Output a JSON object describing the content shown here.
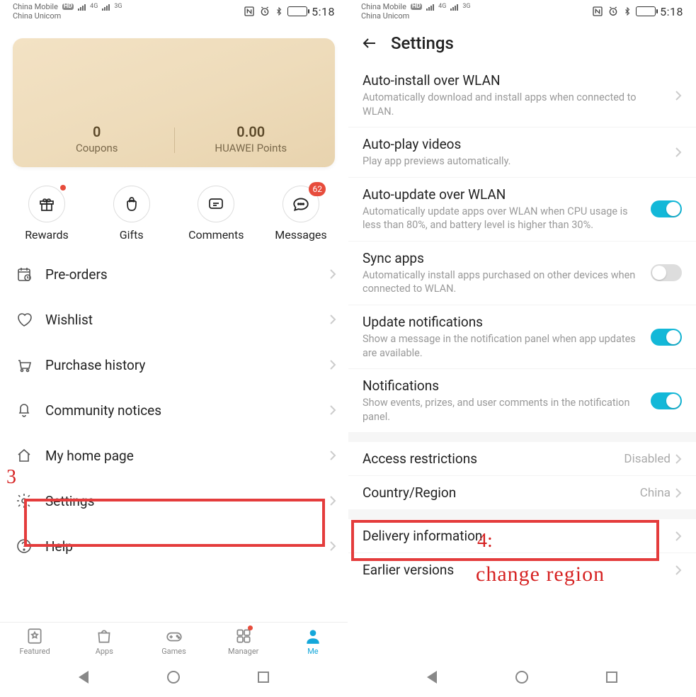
{
  "status": {
    "carrier1": "China Mobile",
    "carrier2": "China Unicom",
    "netlabel1": "4G",
    "netlabel2": "3G",
    "time": "5:18"
  },
  "left": {
    "coupons_val": "0",
    "coupons_label": "Coupons",
    "points_val": "0.00",
    "points_label": "HUAWEI Points",
    "icons": {
      "rewards": "Rewards",
      "gifts": "Gifts",
      "comments": "Comments",
      "messages": "Messages",
      "messages_badge": "62"
    },
    "menu": {
      "preorders": "Pre-orders",
      "wishlist": "Wishlist",
      "purchase": "Purchase history",
      "community": "Community notices",
      "myhome": "My home page",
      "settings": "Settings",
      "help": "Help"
    },
    "tabs": {
      "featured": "Featured",
      "apps": "Apps",
      "games": "Games",
      "manager": "Manager",
      "me": "Me"
    }
  },
  "right": {
    "title": "Settings",
    "items": {
      "autoinstall_t": "Auto-install over WLAN",
      "autoinstall_d": "Automatically download and install apps when connected to WLAN.",
      "autoplay_t": "Auto-play videos",
      "autoplay_d": "Play app previews automatically.",
      "autoupdate_t": "Auto-update over WLAN",
      "autoupdate_d": "Automatically update apps over WLAN when CPU usage is less than 80%, and battery level is higher than 30%.",
      "sync_t": "Sync apps",
      "sync_d": "Automatically install apps purchased on other devices when connected to WLAN.",
      "updatenotif_t": "Update notifications",
      "updatenotif_d": "Show a message in the notification panel when app updates are available.",
      "notif_t": "Notifications",
      "notif_d": "Show events, prizes, and user comments in the notification panel.",
      "access_t": "Access restrictions",
      "access_v": "Disabled",
      "country_t": "Country/Region",
      "country_v": "China",
      "delivery_t": "Delivery information",
      "earlier_t": "Earlier versions"
    }
  },
  "anno": {
    "step3": "3",
    "step4": "4:",
    "change": "change region"
  }
}
